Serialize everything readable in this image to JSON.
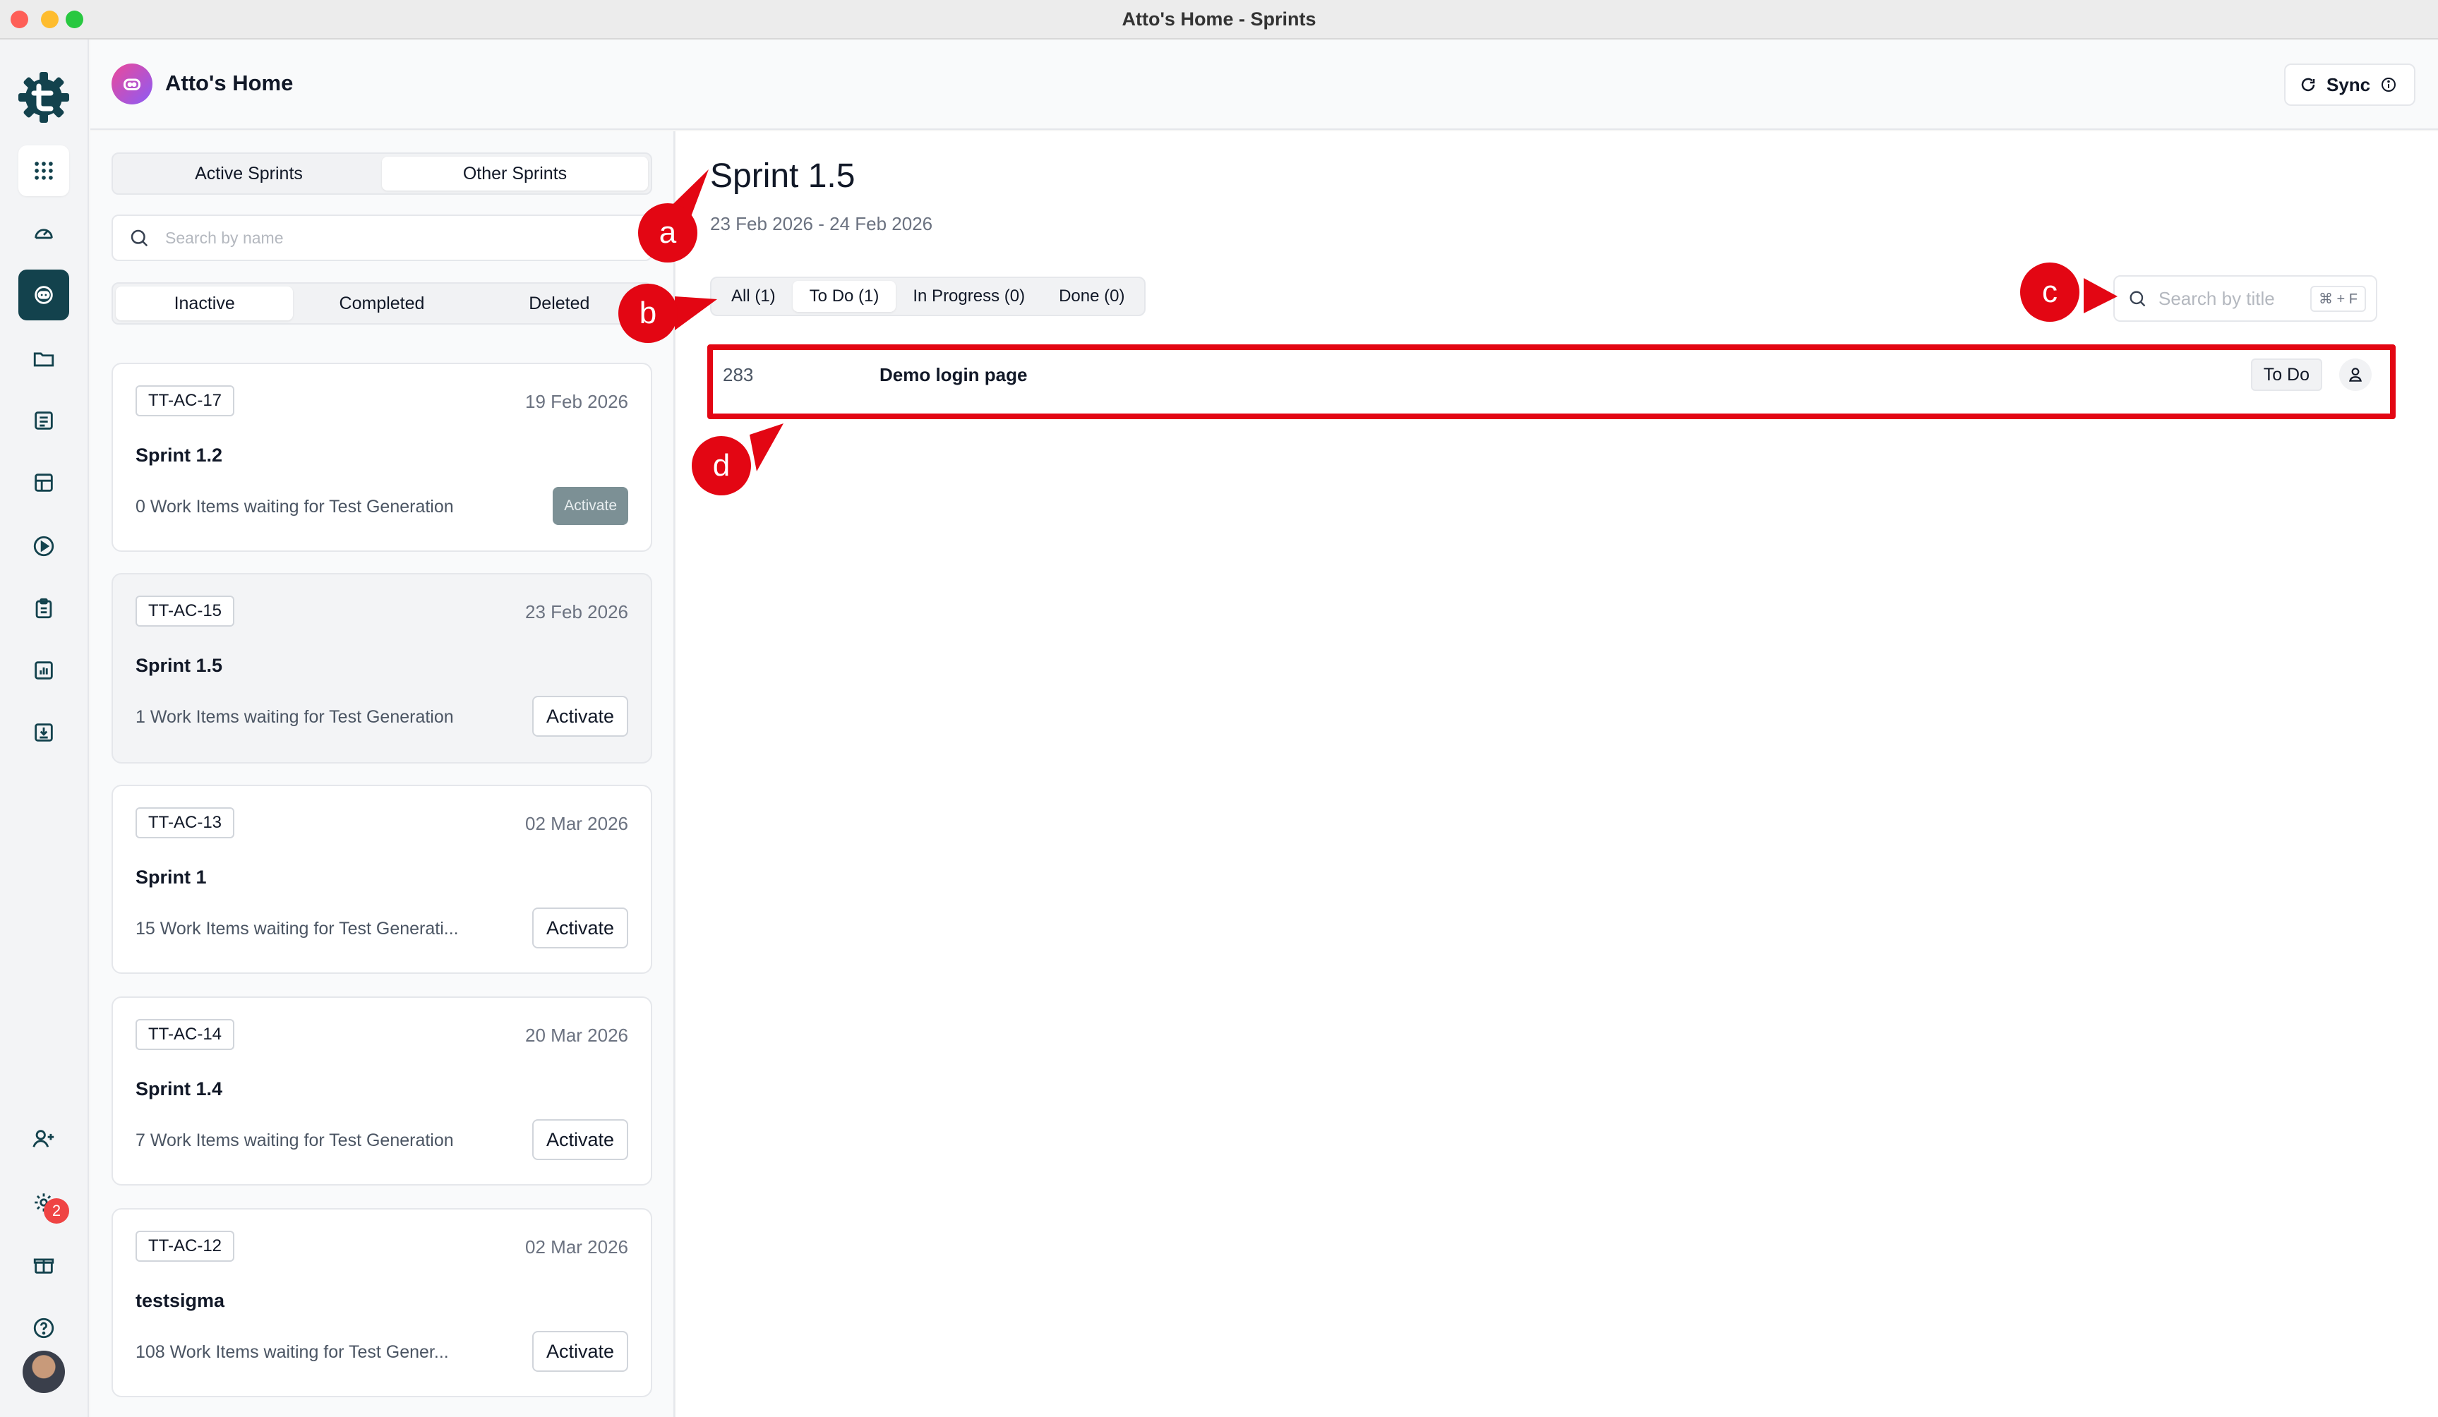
{
  "window": {
    "title": "Atto's Home - Sprints"
  },
  "header": {
    "title": "Atto's Home",
    "sync_label": "Sync"
  },
  "rail": {
    "notification_count": "2"
  },
  "sidebar": {
    "sprint_tabs": [
      {
        "label": "Active Sprints"
      },
      {
        "label": "Other Sprints"
      }
    ],
    "search_placeholder": "Search by name",
    "status_tabs": [
      {
        "label": "Inactive"
      },
      {
        "label": "Completed"
      },
      {
        "label": "Deleted"
      }
    ],
    "sprints": [
      {
        "tag": "TT-AC-17",
        "date": "19 Feb 2026",
        "name": "Sprint 1.2",
        "info": "0 Work Items waiting for Test Generation",
        "action": "Activate"
      },
      {
        "tag": "TT-AC-15",
        "date": "23 Feb 2026",
        "name": "Sprint 1.5",
        "info": "1 Work Items waiting for Test Generation",
        "action": "Activate"
      },
      {
        "tag": "TT-AC-13",
        "date": "02 Mar 2026",
        "name": "Sprint 1",
        "info": "15 Work Items waiting for Test Generati...",
        "action": "Activate"
      },
      {
        "tag": "TT-AC-14",
        "date": "20 Mar 2026",
        "name": "Sprint 1.4",
        "info": "7 Work Items waiting for Test Generation",
        "action": "Activate"
      },
      {
        "tag": "TT-AC-12",
        "date": "02 Mar 2026",
        "name": "testsigma",
        "info": "108 Work Items waiting for Test Gener...",
        "action": "Activate"
      }
    ]
  },
  "main": {
    "title": "Sprint 1.5",
    "dates": "23 Feb 2026 - 24 Feb 2026",
    "filters": [
      {
        "label": "All (1)"
      },
      {
        "label": "To Do (1)"
      },
      {
        "label": "In Progress (0)"
      },
      {
        "label": "Done (0)"
      }
    ],
    "search_placeholder": "Search by title",
    "search_shortcut": "⌘ + F",
    "items": [
      {
        "id": "283",
        "title": "Demo login page",
        "status": "To Do"
      }
    ]
  },
  "annotations": {
    "a": "a",
    "b": "b",
    "c": "c",
    "d": "d"
  },
  "colors": {
    "accent": "#13424d",
    "marker": "#e30613",
    "badge": "#ef4444"
  }
}
